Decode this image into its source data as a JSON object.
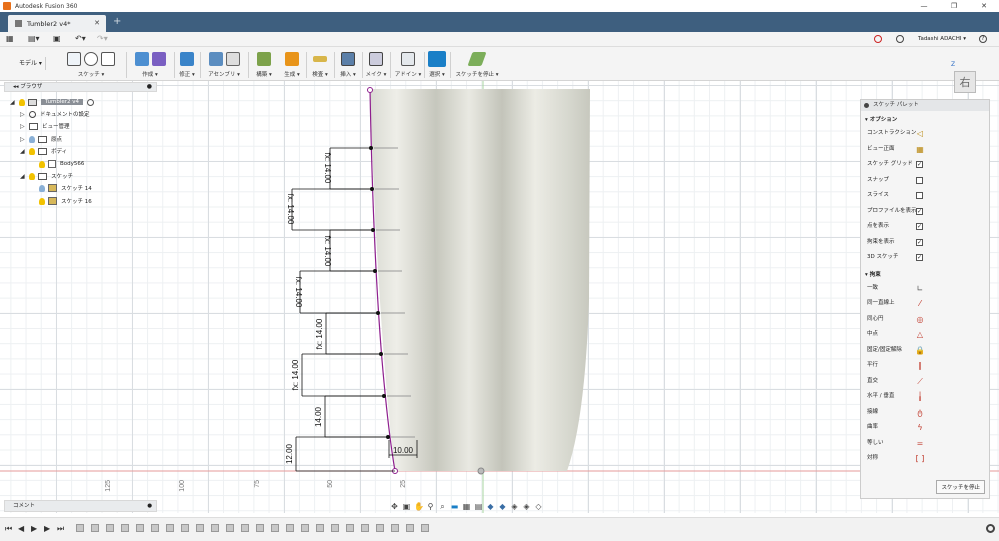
{
  "app": {
    "title": "Autodesk Fusion 360"
  },
  "tab": {
    "label": "Tumbler2 v4*"
  },
  "user": {
    "name": "Tadashi ADACHI ▾"
  },
  "ribbon": {
    "mode": "モデル",
    "groups": [
      "スケッチ ▾",
      "作成 ▾",
      "修正 ▾",
      "アセンブリ ▾",
      "構築 ▾",
      "検査 ▾",
      "挿入 ▾",
      "メイク ▾",
      "アドイン ▾",
      "選択 ▾",
      "スケッチを停止 ▾"
    ]
  },
  "browser": {
    "title": "ブラウザ",
    "root": "Tumbler2 v4",
    "items": [
      "ドキュメントの設定",
      "ビュー管理",
      "原点",
      "ボディ",
      "Body566",
      "スケッチ",
      "スケッチ 14",
      "スケッチ 16"
    ]
  },
  "comment": {
    "label": "コメント"
  },
  "navcube": {
    "face": "右",
    "axis": "Z"
  },
  "dimensions": {
    "segments": [
      "fx: 14.00",
      "fx: 14.00",
      "fx: 14.00",
      "fx: 14.00",
      "fx: 14.00",
      "fx: 14.00",
      "14.00"
    ],
    "bottom": "12.00",
    "base": "10.00"
  },
  "ruler": {
    "labels": [
      "125",
      "100",
      "75",
      "50",
      "25"
    ]
  },
  "palette": {
    "title": "スケッチ パレット",
    "options_title": "オプション",
    "options": [
      {
        "label": "コンストラクション",
        "kind": "icon",
        "icon": "construction-icon",
        "glyph": "◁"
      },
      {
        "label": "ビュー正面",
        "kind": "icon",
        "icon": "look-at-icon",
        "glyph": "▦"
      },
      {
        "label": "スケッチ グリッド",
        "kind": "check",
        "checked": true
      },
      {
        "label": "スナップ",
        "kind": "check",
        "checked": false
      },
      {
        "label": "スライス",
        "kind": "check",
        "checked": false
      },
      {
        "label": "プロファイルを表示",
        "kind": "check",
        "checked": true
      },
      {
        "label": "点を表示",
        "kind": "check",
        "checked": true
      },
      {
        "label": "拘束を表示",
        "kind": "check",
        "checked": true
      },
      {
        "label": "3D スケッチ",
        "kind": "check",
        "checked": true
      }
    ],
    "constraints_title": "拘束",
    "constraints": [
      {
        "label": "一致",
        "icon": "coincident-icon",
        "glyph": "∟",
        "color": "#555555"
      },
      {
        "label": "同一直線上",
        "icon": "collinear-icon",
        "glyph": "⁄",
        "color": "#c0392b"
      },
      {
        "label": "同心円",
        "icon": "concentric-icon",
        "glyph": "◎",
        "color": "#c0392b"
      },
      {
        "label": "中点",
        "icon": "midpoint-icon",
        "glyph": "△",
        "color": "#c0392b"
      },
      {
        "label": "固定/固定解除",
        "icon": "lock-icon",
        "glyph": "🔒",
        "color": "#c0392b"
      },
      {
        "label": "平行",
        "icon": "parallel-icon",
        "glyph": "∥",
        "color": "#c0392b"
      },
      {
        "label": "直交",
        "icon": "perpendicular-icon",
        "glyph": "⟋",
        "color": "#c0392b"
      },
      {
        "label": "水平 / 垂直",
        "icon": "horizontal-vertical-icon",
        "glyph": "╽",
        "color": "#c0392b"
      },
      {
        "label": "接線",
        "icon": "tangent-icon",
        "glyph": "ტ",
        "color": "#c0392b"
      },
      {
        "label": "曲率",
        "icon": "curvature-icon",
        "glyph": "ϟ",
        "color": "#c0392b"
      },
      {
        "label": "等しい",
        "icon": "equal-icon",
        "glyph": "=",
        "color": "#c0392b"
      },
      {
        "label": "対称",
        "icon": "symmetry-icon",
        "glyph": "[ ]",
        "color": "#c0392b"
      }
    ],
    "stop_button": "スケッチを停止"
  },
  "colors": {
    "titlebar": "#3e5f7f",
    "accent": "#1a7fc7",
    "sketch_line": "#8e1f8e",
    "body": "#e2e2da"
  }
}
